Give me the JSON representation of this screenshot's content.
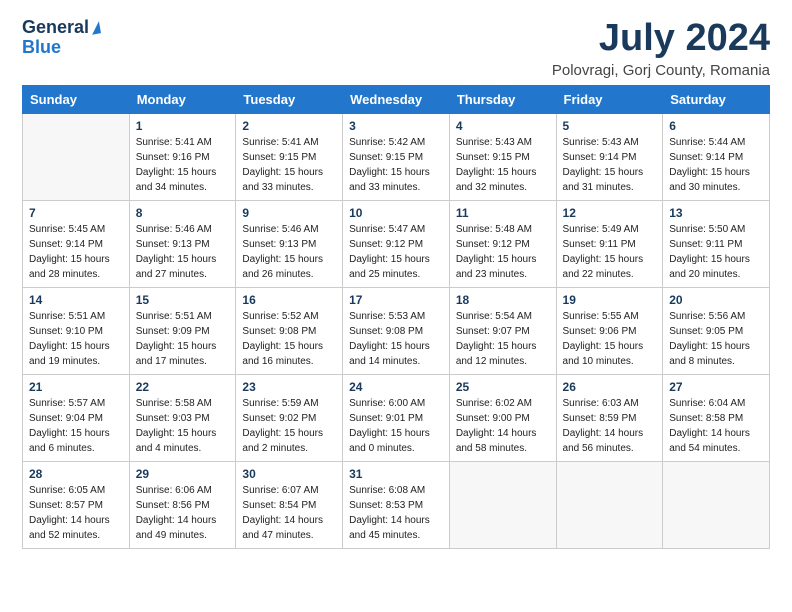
{
  "header": {
    "logo_general": "General",
    "logo_blue": "Blue",
    "title": "July 2024",
    "location": "Polovragi, Gorj County, Romania"
  },
  "days_of_week": [
    "Sunday",
    "Monday",
    "Tuesday",
    "Wednesday",
    "Thursday",
    "Friday",
    "Saturday"
  ],
  "weeks": [
    [
      {
        "day": "",
        "info": ""
      },
      {
        "day": "1",
        "info": "Sunrise: 5:41 AM\nSunset: 9:16 PM\nDaylight: 15 hours\nand 34 minutes."
      },
      {
        "day": "2",
        "info": "Sunrise: 5:41 AM\nSunset: 9:15 PM\nDaylight: 15 hours\nand 33 minutes."
      },
      {
        "day": "3",
        "info": "Sunrise: 5:42 AM\nSunset: 9:15 PM\nDaylight: 15 hours\nand 33 minutes."
      },
      {
        "day": "4",
        "info": "Sunrise: 5:43 AM\nSunset: 9:15 PM\nDaylight: 15 hours\nand 32 minutes."
      },
      {
        "day": "5",
        "info": "Sunrise: 5:43 AM\nSunset: 9:14 PM\nDaylight: 15 hours\nand 31 minutes."
      },
      {
        "day": "6",
        "info": "Sunrise: 5:44 AM\nSunset: 9:14 PM\nDaylight: 15 hours\nand 30 minutes."
      }
    ],
    [
      {
        "day": "7",
        "info": "Sunrise: 5:45 AM\nSunset: 9:14 PM\nDaylight: 15 hours\nand 28 minutes."
      },
      {
        "day": "8",
        "info": "Sunrise: 5:46 AM\nSunset: 9:13 PM\nDaylight: 15 hours\nand 27 minutes."
      },
      {
        "day": "9",
        "info": "Sunrise: 5:46 AM\nSunset: 9:13 PM\nDaylight: 15 hours\nand 26 minutes."
      },
      {
        "day": "10",
        "info": "Sunrise: 5:47 AM\nSunset: 9:12 PM\nDaylight: 15 hours\nand 25 minutes."
      },
      {
        "day": "11",
        "info": "Sunrise: 5:48 AM\nSunset: 9:12 PM\nDaylight: 15 hours\nand 23 minutes."
      },
      {
        "day": "12",
        "info": "Sunrise: 5:49 AM\nSunset: 9:11 PM\nDaylight: 15 hours\nand 22 minutes."
      },
      {
        "day": "13",
        "info": "Sunrise: 5:50 AM\nSunset: 9:11 PM\nDaylight: 15 hours\nand 20 minutes."
      }
    ],
    [
      {
        "day": "14",
        "info": "Sunrise: 5:51 AM\nSunset: 9:10 PM\nDaylight: 15 hours\nand 19 minutes."
      },
      {
        "day": "15",
        "info": "Sunrise: 5:51 AM\nSunset: 9:09 PM\nDaylight: 15 hours\nand 17 minutes."
      },
      {
        "day": "16",
        "info": "Sunrise: 5:52 AM\nSunset: 9:08 PM\nDaylight: 15 hours\nand 16 minutes."
      },
      {
        "day": "17",
        "info": "Sunrise: 5:53 AM\nSunset: 9:08 PM\nDaylight: 15 hours\nand 14 minutes."
      },
      {
        "day": "18",
        "info": "Sunrise: 5:54 AM\nSunset: 9:07 PM\nDaylight: 15 hours\nand 12 minutes."
      },
      {
        "day": "19",
        "info": "Sunrise: 5:55 AM\nSunset: 9:06 PM\nDaylight: 15 hours\nand 10 minutes."
      },
      {
        "day": "20",
        "info": "Sunrise: 5:56 AM\nSunset: 9:05 PM\nDaylight: 15 hours\nand 8 minutes."
      }
    ],
    [
      {
        "day": "21",
        "info": "Sunrise: 5:57 AM\nSunset: 9:04 PM\nDaylight: 15 hours\nand 6 minutes."
      },
      {
        "day": "22",
        "info": "Sunrise: 5:58 AM\nSunset: 9:03 PM\nDaylight: 15 hours\nand 4 minutes."
      },
      {
        "day": "23",
        "info": "Sunrise: 5:59 AM\nSunset: 9:02 PM\nDaylight: 15 hours\nand 2 minutes."
      },
      {
        "day": "24",
        "info": "Sunrise: 6:00 AM\nSunset: 9:01 PM\nDaylight: 15 hours\nand 0 minutes."
      },
      {
        "day": "25",
        "info": "Sunrise: 6:02 AM\nSunset: 9:00 PM\nDaylight: 14 hours\nand 58 minutes."
      },
      {
        "day": "26",
        "info": "Sunrise: 6:03 AM\nSunset: 8:59 PM\nDaylight: 14 hours\nand 56 minutes."
      },
      {
        "day": "27",
        "info": "Sunrise: 6:04 AM\nSunset: 8:58 PM\nDaylight: 14 hours\nand 54 minutes."
      }
    ],
    [
      {
        "day": "28",
        "info": "Sunrise: 6:05 AM\nSunset: 8:57 PM\nDaylight: 14 hours\nand 52 minutes."
      },
      {
        "day": "29",
        "info": "Sunrise: 6:06 AM\nSunset: 8:56 PM\nDaylight: 14 hours\nand 49 minutes."
      },
      {
        "day": "30",
        "info": "Sunrise: 6:07 AM\nSunset: 8:54 PM\nDaylight: 14 hours\nand 47 minutes."
      },
      {
        "day": "31",
        "info": "Sunrise: 6:08 AM\nSunset: 8:53 PM\nDaylight: 14 hours\nand 45 minutes."
      },
      {
        "day": "",
        "info": ""
      },
      {
        "day": "",
        "info": ""
      },
      {
        "day": "",
        "info": ""
      }
    ]
  ]
}
